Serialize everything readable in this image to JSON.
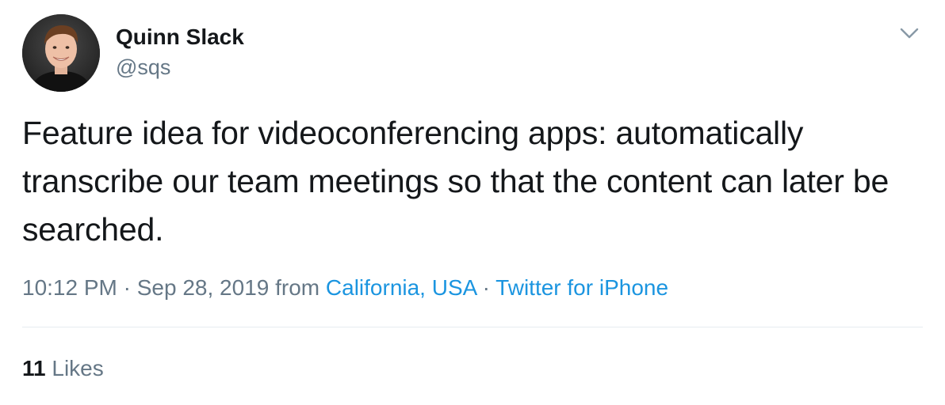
{
  "author": {
    "display_name": "Quinn Slack",
    "handle": "@sqs"
  },
  "tweet": {
    "text": "Feature idea for videoconferencing apps: automatically transcribe our team meetings so that the content can later be searched."
  },
  "meta": {
    "time": "10:12 PM",
    "separator": "·",
    "date": "Sep 28, 2019",
    "from_label": "from",
    "location": "California, USA",
    "source": "Twitter for iPhone"
  },
  "stats": {
    "likes_count": "11",
    "likes_label": "Likes"
  },
  "icons": {
    "caret": "chevron-down-icon"
  },
  "colors": {
    "text_primary": "#14171a",
    "text_secondary": "#657786",
    "link": "#1b95e0",
    "divider": "#e6ecf0"
  }
}
